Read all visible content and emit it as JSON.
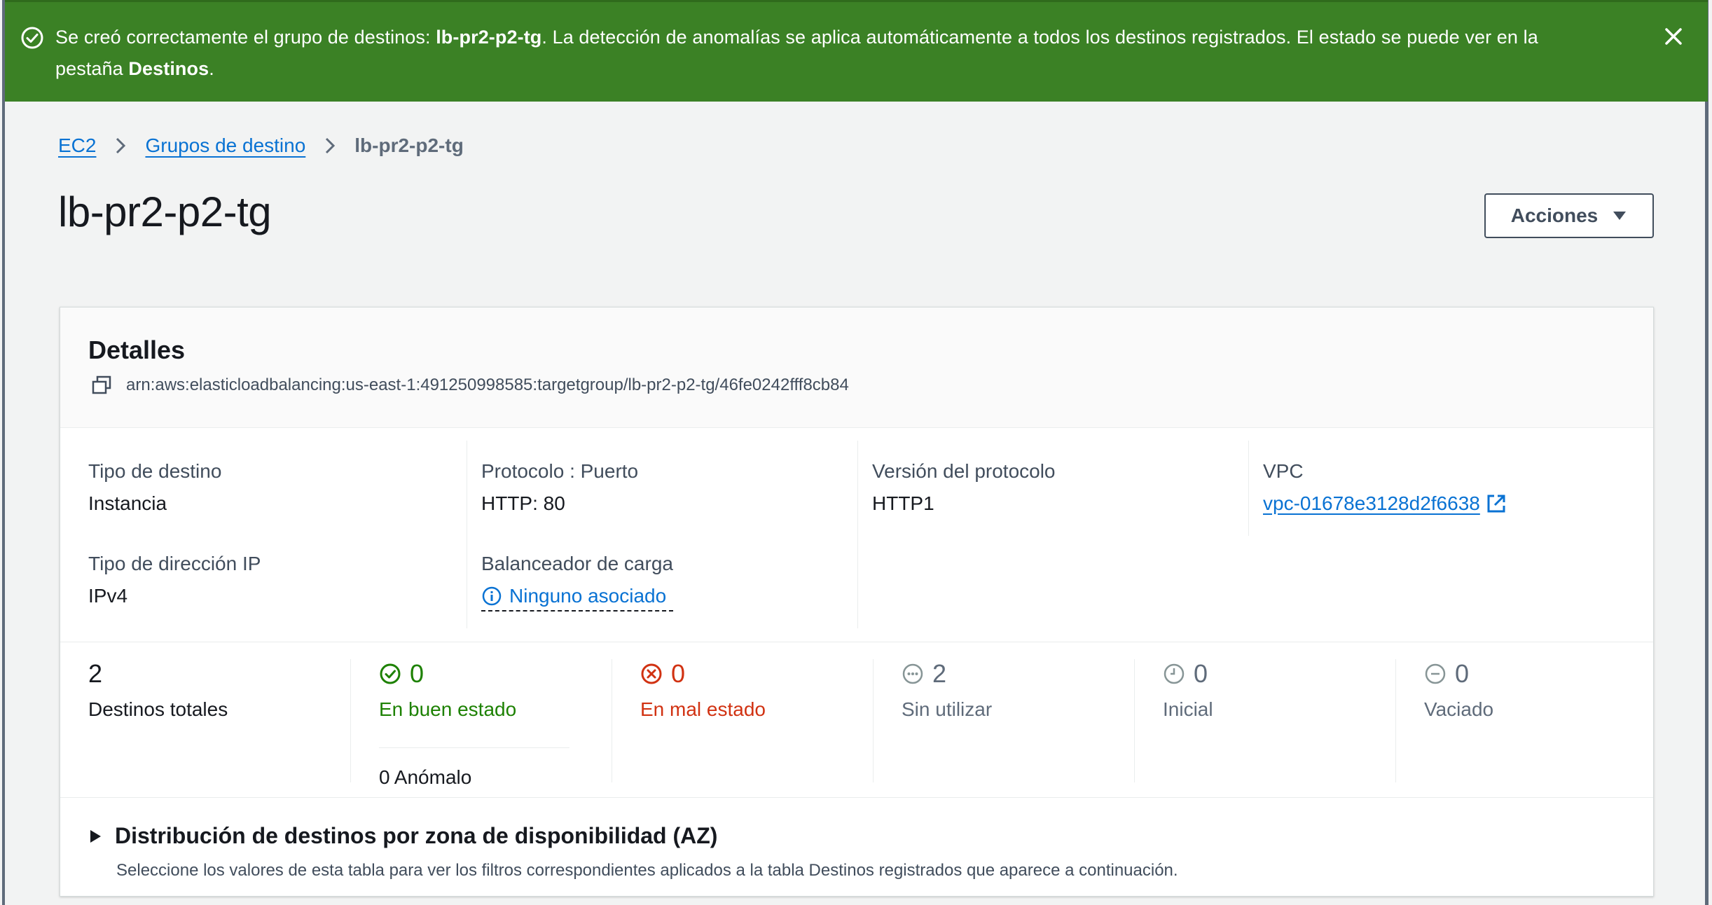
{
  "flash": {
    "message_prefix": "Se creó correctamente el grupo de destinos: ",
    "target_group_name": "lb-pr2-p2-tg",
    "message_middle": ". La detección de anomalías se aplica automáticamente a todos los destinos registrados. El estado se puede ver en la pestaña ",
    "tab_name": "Destinos",
    "message_suffix": ".",
    "color": "#3b8125"
  },
  "breadcrumb": {
    "items": [
      "EC2",
      "Grupos de destino"
    ],
    "current": "lb-pr2-p2-tg"
  },
  "page": {
    "title": "lb-pr2-p2-tg",
    "actions_label": "Acciones"
  },
  "details": {
    "title": "Detalles",
    "arn": "arn:aws:elasticloadbalancing:us-east-1:491250998585:targetgroup/lb-pr2-p2-tg/46fe0242fff8cb84",
    "target_type": {
      "label": "Tipo de destino",
      "value": "Instancia"
    },
    "ip_type": {
      "label": "Tipo de dirección IP",
      "value": "IPv4"
    },
    "protocol_port": {
      "label": "Protocolo : Puerto",
      "value": "HTTP: 80"
    },
    "load_balancer": {
      "label": "Balanceador de carga",
      "value": "Ninguno asociado"
    },
    "protocol_version": {
      "label": "Versión del protocolo",
      "value": "HTTP1"
    },
    "vpc": {
      "label": "VPC",
      "value": "vpc-01678e3128d2f6638"
    }
  },
  "stats": {
    "total": {
      "count": "2",
      "label": "Destinos totales"
    },
    "healthy": {
      "count": "0",
      "label": "En buen estado",
      "color": "#1d8102"
    },
    "anomalous": "0 Anómalo",
    "unhealthy": {
      "count": "0",
      "label": "En mal estado",
      "color": "#d13212"
    },
    "unused": {
      "count": "2",
      "label": "Sin utilizar"
    },
    "initial": {
      "count": "0",
      "label": "Inicial"
    },
    "draining": {
      "count": "0",
      "label": "Vaciado"
    }
  },
  "az_distribution": {
    "title": "Distribución de destinos por zona de disponibilidad (AZ)",
    "description": "Seleccione los valores de esta tabla para ver los filtros correspondientes aplicados a la tabla Destinos registrados que aparece a continuación."
  },
  "icons": [
    "success-icon",
    "close-icon",
    "chevron-right-icon",
    "caret-down-icon",
    "copy-icon",
    "info-icon",
    "external-link-icon",
    "status-ok-icon",
    "status-error-icon",
    "status-unused-icon",
    "status-initial-icon",
    "status-draining-icon",
    "expand-triangle-icon"
  ]
}
